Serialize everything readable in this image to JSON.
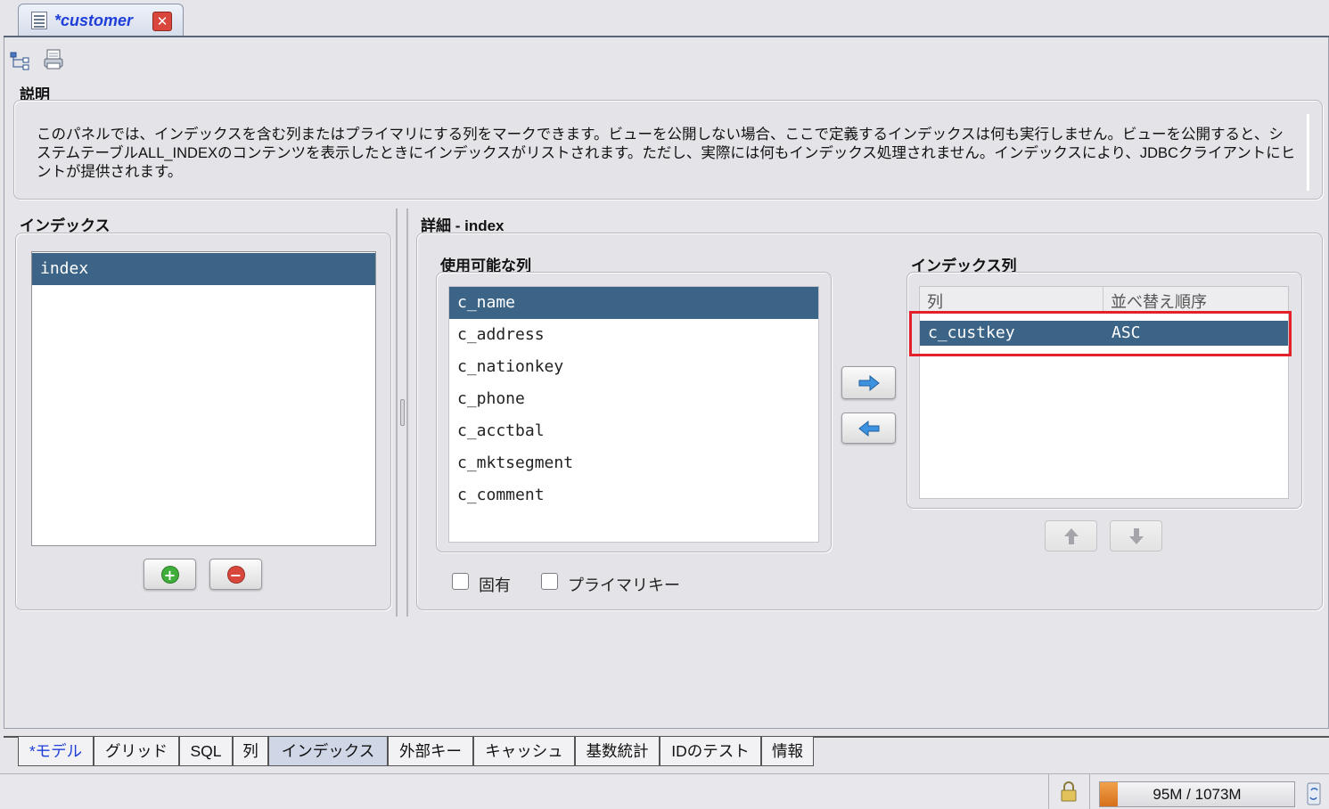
{
  "editor_tab": {
    "title": "*customer",
    "close_symbol": "✕"
  },
  "description": {
    "label": "説明",
    "text": "このパネルでは、インデックスを含む列またはプライマリにする列をマークできます。ビューを公開しない場合、ここで定義するインデックスは何も実行しません。ビューを公開すると、システムテーブルALL_INDEXのコンテンツを表示したときにインデックスがリストされます。ただし、実際には何もインデックス処理されません。インデックスにより、JDBCクライアントにヒントが提供されます。"
  },
  "indexes": {
    "label": "インデックス",
    "items": [
      "index"
    ],
    "add_symbol": "+",
    "remove_symbol": "−"
  },
  "details": {
    "label": "詳細 - index",
    "available_label": "使用可能な列",
    "available_columns": [
      "c_name",
      "c_address",
      "c_nationkey",
      "c_phone",
      "c_acctbal",
      "c_mktsegment",
      "c_comment"
    ],
    "index_columns_label": "インデックス列",
    "table_headers": {
      "column": "列",
      "sort_order": "並べ替え順序"
    },
    "rows": [
      {
        "column": "c_custkey",
        "order": "ASC"
      }
    ],
    "unique_label": "固有",
    "primary_key_label": "プライマリキー"
  },
  "bottom_tabs": [
    "*モデル",
    "グリッド",
    "SQL",
    "列",
    "インデックス",
    "外部キー",
    "キャッシュ",
    "基数統計",
    "IDのテスト",
    "情報"
  ],
  "status": {
    "memory": "95M / 1073M",
    "memory_fraction": 0.09
  },
  "colors": {
    "selection": "#3c6487",
    "highlight_box": "#e4202a",
    "tab_title": "#1f3fd8",
    "add": "#3fae3a",
    "remove": "#d9473c"
  }
}
